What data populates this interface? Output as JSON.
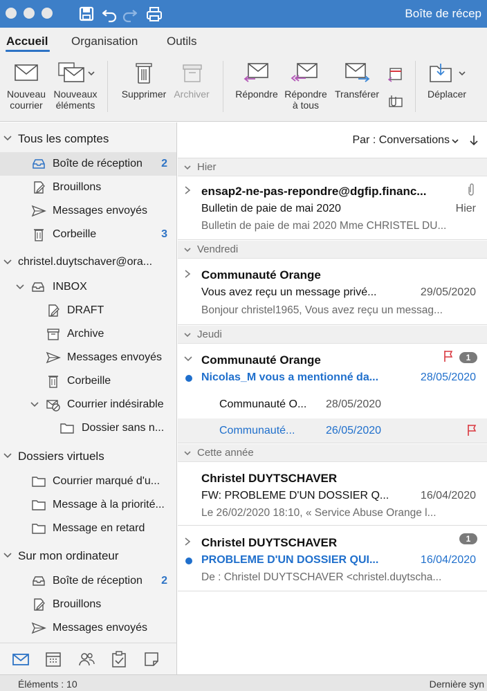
{
  "window": {
    "title": "Boîte de récep"
  },
  "tabs": [
    {
      "label": "Accueil",
      "active": true
    },
    {
      "label": "Organisation",
      "active": false
    },
    {
      "label": "Outils",
      "active": false
    }
  ],
  "ribbon": {
    "new_mail": "Nouveau courrier",
    "new_mail_l1": "Nouveau",
    "new_mail_l2": "courrier",
    "new_items_l1": "Nouveaux",
    "new_items_l2": "éléments",
    "delete": "Supprimer",
    "archive": "Archiver",
    "reply": "Répondre",
    "reply_all_l1": "Répondre",
    "reply_all_l2": "à tous",
    "forward": "Transférer",
    "move": "Déplacer"
  },
  "folders": {
    "all_accounts": "Tous les comptes",
    "all_inbox": "Boîte de réception",
    "all_inbox_count": "2",
    "all_drafts": "Brouillons",
    "all_sent": "Messages envoyés",
    "all_trash": "Corbeille",
    "all_trash_count": "3",
    "account": "christel.duytschaver@ora...",
    "inbox": "INBOX",
    "draft": "DRAFT",
    "archive": "Archive",
    "acc_sent": "Messages envoyés",
    "acc_trash": "Corbeille",
    "junk": "Courrier indésirable",
    "untitled": "Dossier sans n...",
    "smart": "Dossiers virtuels",
    "smart_flagged": "Courrier marqué d'u...",
    "smart_priority": "Message à la priorité...",
    "smart_overdue": "Message en retard",
    "on_computer": "Sur mon ordinateur",
    "local_inbox": "Boîte de réception",
    "local_inbox_count": "2",
    "local_drafts": "Brouillons",
    "local_sent": "Messages envoyés"
  },
  "sort": {
    "label": "Par : Conversations"
  },
  "groups": {
    "g1": "Hier",
    "g2": "Vendredi",
    "g3": "Jeudi",
    "g4": "Cette année"
  },
  "messages": [
    {
      "sender": "ensap2-ne-pas-repondre@dgfip.financ...",
      "subject": "Bulletin de paie de mai 2020",
      "date": "Hier",
      "preview": "Bulletin de paie de mai 2020 Mme CHRISTEL DU..."
    },
    {
      "sender": "Communauté Orange",
      "subject": "Vous avez reçu un message privé...",
      "date": "29/05/2020",
      "preview": "Bonjour christel1965, Vous avez reçu un messag..."
    },
    {
      "sender": "Communauté Orange",
      "subject": "Nicolas_M vous a mentionné da...",
      "date": "28/05/2020",
      "badge": "1"
    },
    {
      "sender": "Christel DUYTSCHAVER",
      "subject": "FW: PROBLEME D'UN DOSSIER Q...",
      "date": "16/04/2020",
      "preview": "Le 26/02/2020 18:10, « Service Abuse Orange l..."
    },
    {
      "sender": "Christel DUYTSCHAVER",
      "subject": "PROBLEME D'UN DOSSIER QUI...",
      "date": "16/04/2020",
      "preview": "De : Christel DUYTSCHAVER <christel.duytscha...",
      "badge": "1"
    }
  ],
  "thread": [
    {
      "sender": "Communauté O...",
      "date": "28/05/2020"
    },
    {
      "sender": "Communauté...",
      "date": "26/05/2020"
    }
  ],
  "status": {
    "count": "Éléments : 10",
    "sync": "Dernière syn"
  },
  "colors": {
    "accent": "#2d73c5",
    "titlebar": "#3d7fc8",
    "unread": "#1f6fcc",
    "flag": "#d9363e"
  }
}
